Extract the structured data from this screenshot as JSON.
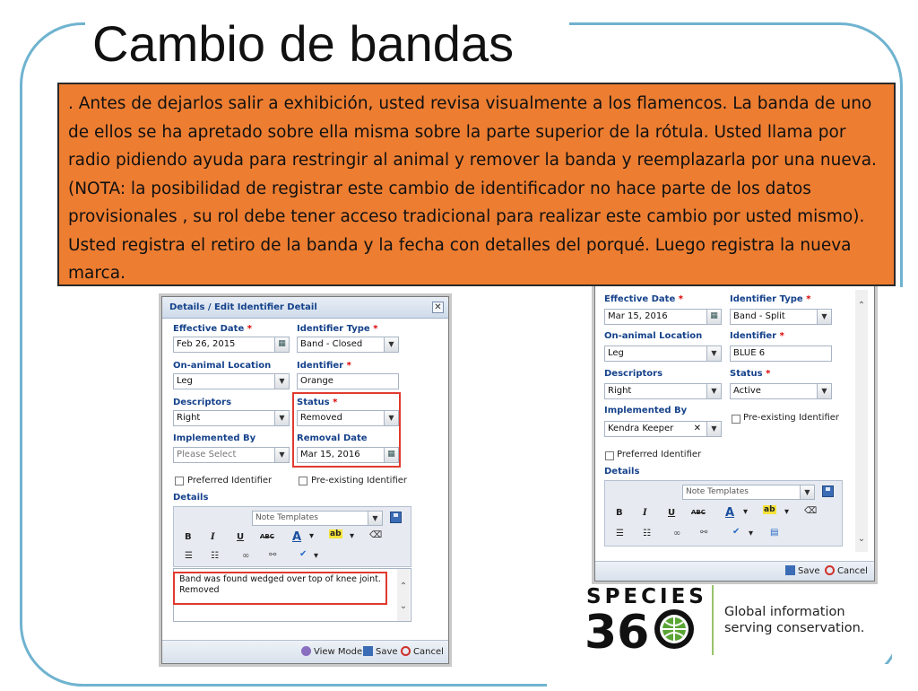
{
  "slide": {
    "title": "Cambio de bandas",
    "callout_text": ". Antes de dejarlos salir a exhibición, usted revisa visualmente a los flamencos. La banda de uno de ellos se ha apretado sobre ella misma sobre la parte superior de la rótula. Usted llama por radio pidiendo ayuda para  restringir al animal y remover la banda y reemplazarla por una nueva. (NOTA: la posibilidad de registrar este cambio de identificador no hace parte de los datos provisionales , su rol debe tener acceso tradicional para realizar este cambio por usted mismo). Usted registra el retiro de la banda y la fecha con detalles del porqué. Luego registra la nueva marca."
  },
  "colors": {
    "callout": "#ed7d31",
    "frame": "#6fb3cf",
    "highlight": "#e03a2f",
    "label": "#15428b"
  },
  "left_dialog": {
    "title": "Details / Edit Identifier Detail",
    "close": "✕",
    "effective_date_label": "Effective Date",
    "effective_date_value": "Feb 26, 2015",
    "identifier_type_label": "Identifier Type",
    "identifier_type_value": "Band - Closed",
    "location_label": "On-animal Location",
    "location_value": "Leg",
    "identifier_label": "Identifier",
    "identifier_value": "Orange",
    "descriptors_label": "Descriptors",
    "descriptors_value": "Right",
    "status_label": "Status",
    "status_value": "Removed",
    "implemented_by_label": "Implemented By",
    "implemented_by_placeholder": "Please Select",
    "removal_date_label": "Removal Date",
    "removal_date_value": "Mar 15, 2016",
    "preferred_label": "Preferred Identifier",
    "preexisting_label": "Pre-existing Identifier",
    "details_label": "Details",
    "note_templates": "Note Templates",
    "details_text_1": "Band was found wedged over top of knee joint.",
    "details_text_2": "Removed",
    "view_mode": "View Mode",
    "save": "Save",
    "cancel": "Cancel",
    "required_mark": "*"
  },
  "right_dialog": {
    "effective_date_label": "Effective Date",
    "effective_date_value": "Mar 15, 2016",
    "identifier_type_label": "Identifier Type",
    "identifier_type_value": "Band - Split",
    "location_label": "On-animal Location",
    "location_value": "Leg",
    "identifier_label": "Identifier",
    "identifier_value": "BLUE 6",
    "descriptors_label": "Descriptors",
    "descriptors_value": "Right",
    "status_label": "Status",
    "status_value": "Active",
    "implemented_by_label": "Implemented By",
    "implemented_by_value": "Kendra Keeper",
    "preexisting_label": "Pre-existing Identifier",
    "preferred_label": "Preferred Identifier",
    "details_label": "Details",
    "note_templates": "Note Templates",
    "save": "Save",
    "cancel": "Cancel",
    "required_mark": "*"
  },
  "toolbar": {
    "bold": "B",
    "italic": "I",
    "underline": "U",
    "strike": "ABC",
    "font_color": "A",
    "highlight": "ab",
    "dropdown": "▾"
  },
  "logo": {
    "line1": "SPECIES",
    "line2": "360",
    "tagline_1": "Global information",
    "tagline_2": "serving conservation."
  }
}
